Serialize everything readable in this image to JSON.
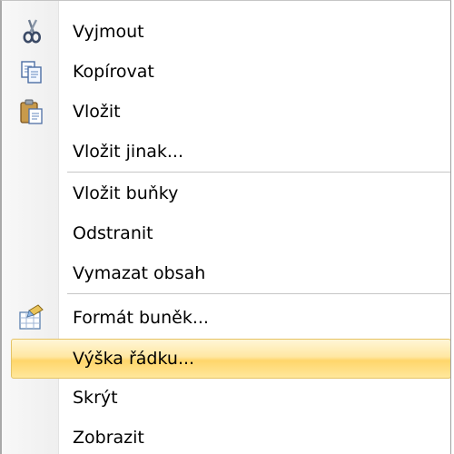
{
  "menu": {
    "items": [
      {
        "label": "Vyjmout",
        "icon": "scissors-icon"
      },
      {
        "label": "Kopírovat",
        "icon": "copy-icon"
      },
      {
        "label": "Vložit",
        "icon": "paste-icon"
      },
      {
        "label": "Vložit jinak..."
      },
      {
        "label": "Vložit buňky"
      },
      {
        "label": "Odstranit"
      },
      {
        "label": "Vymazat obsah"
      },
      {
        "label": "Formát buněk...",
        "icon": "format-cells-icon"
      },
      {
        "label": "Výška řádku...",
        "selected": true
      },
      {
        "label": "Skrýt"
      },
      {
        "label": "Zobrazit"
      }
    ]
  },
  "colors": {
    "highlight_top": "#fff6d7",
    "highlight_bottom": "#ffd66b",
    "highlight_border": "#e5c365",
    "gutter": "#f2f2f2",
    "separator": "#c6c6c6"
  }
}
